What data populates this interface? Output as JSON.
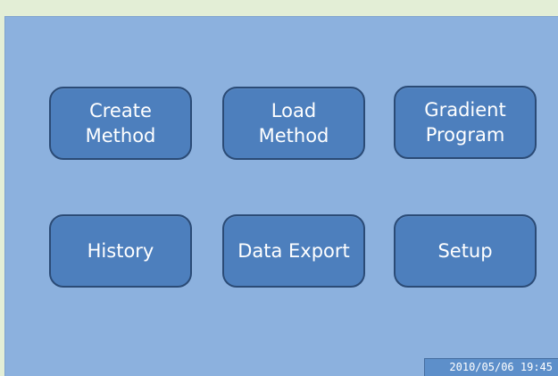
{
  "menu": {
    "create_method": "Create\nMethod",
    "load_method": "Load\nMethod",
    "gradient_program": "Gradient\nProgram",
    "history": "History",
    "data_export": "Data Export",
    "setup": "Setup"
  },
  "status": {
    "timestamp": "2010/05/06  19:45"
  },
  "colors": {
    "background": "#e3eed6",
    "screen": "#8cb1de",
    "button_fill": "#4d7fbd",
    "button_border": "#2b4b76",
    "text": "#ffffff"
  }
}
